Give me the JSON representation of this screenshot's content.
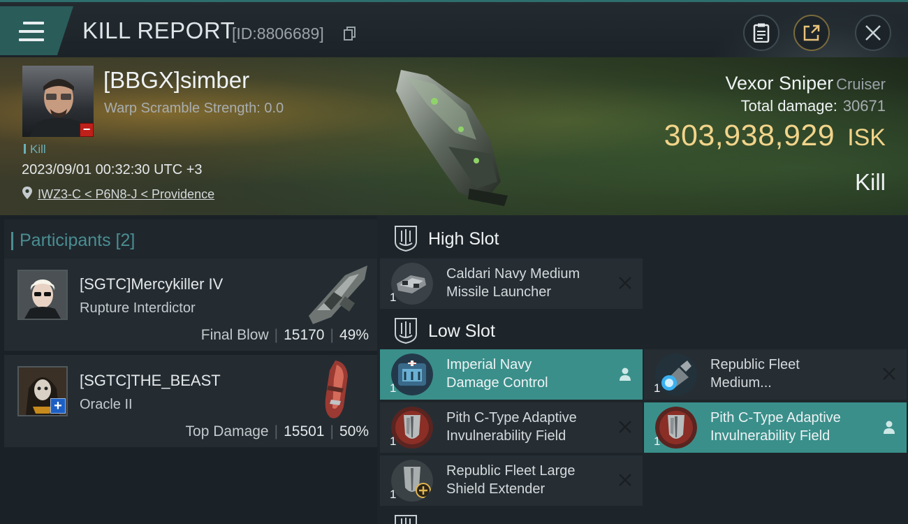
{
  "topbar": {
    "title": "KILL REPORT",
    "report_id": "[ID:8806689]"
  },
  "victim": {
    "name": "[BBGX]simber",
    "warp_scramble": "Warp Scramble Strength: 0.0",
    "tag": "Kill",
    "timestamp": "2023/09/01 00:32:30 UTC +3",
    "location": "IWZ3-C < P6N8-J < Providence",
    "ship_name": "Vexor Sniper",
    "ship_class": "Cruiser",
    "total_damage_label": "Total damage:",
    "total_damage_value": "30671",
    "isk_value": "303,938,929",
    "isk_unit": "ISK",
    "outcome": "Kill"
  },
  "participants": {
    "title": "Participants [2]",
    "rows": [
      {
        "name": "[SGTC]Mercykiller IV",
        "ship": "Rupture Interdictor",
        "role": "Final Blow",
        "damage": "15170",
        "percent": "49%"
      },
      {
        "name": "[SGTC]THE_BEAST",
        "ship": "Oracle II",
        "role": "Top Damage",
        "damage": "15501",
        "percent": "50%"
      }
    ]
  },
  "fitting": {
    "high_slot_title": "High Slot",
    "low_slot_title": "Low Slot",
    "high": [
      {
        "qty": "1",
        "name_line1": "Caldari Navy Medium",
        "name_line2": "Missile Launcher",
        "state": "destroyed"
      }
    ],
    "low": [
      {
        "qty": "1",
        "name_line1": "Imperial Navy",
        "name_line2": "Damage Control",
        "state": "dropped"
      },
      {
        "qty": "1",
        "name_line1": "Republic Fleet",
        "name_line2": "Medium...",
        "state": "destroyed"
      },
      {
        "qty": "1",
        "name_line1": "Pith C-Type Adaptive",
        "name_line2": "Invulnerability Field",
        "state": "destroyed"
      },
      {
        "qty": "1",
        "name_line1": "Pith C-Type Adaptive",
        "name_line2": "Invulnerability Field",
        "state": "dropped"
      },
      {
        "qty": "1",
        "name_line1": "Republic Fleet Large",
        "name_line2": "Shield Extender",
        "state": "destroyed"
      }
    ]
  },
  "colors": {
    "accent_teal": "#3a8f8a",
    "isk_gold": "#f2d48a",
    "danger_red": "#c0201a"
  }
}
